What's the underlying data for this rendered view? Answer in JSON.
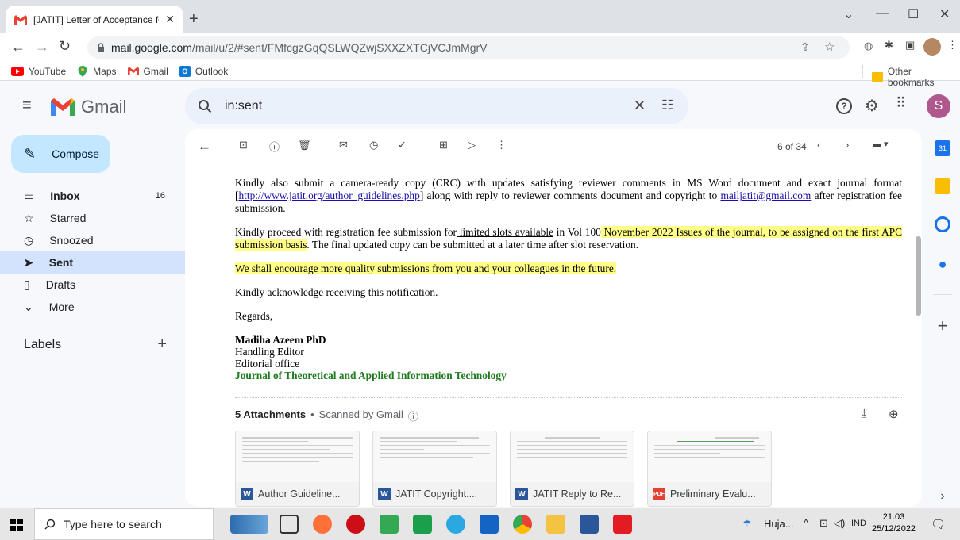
{
  "browser": {
    "tab_title": "[JATIT] Letter of Acceptance for S",
    "url_host": "mail.google.com",
    "url_path": "/mail/u/2/#sent/FMfcgzGqQSLWQZwjSXXZXTCjVCJmMgrV",
    "bookmarks": [
      "YouTube",
      "Maps",
      "Gmail",
      "Outlook"
    ],
    "other_bookmarks": "Other bookmarks"
  },
  "gmail": {
    "logo_text": "Gmail",
    "search_value": "in:sent",
    "compose_label": "Compose",
    "avatar_letter": "S",
    "nav": [
      {
        "label": "Inbox",
        "count": "16"
      },
      {
        "label": "Starred",
        "count": ""
      },
      {
        "label": "Snoozed",
        "count": ""
      },
      {
        "label": "Sent",
        "count": ""
      },
      {
        "label": "Drafts",
        "count": ""
      },
      {
        "label": "More",
        "count": ""
      }
    ],
    "labels_heading": "Labels",
    "pager": "6 of 34"
  },
  "email": {
    "p1_a": "Kindly also submit a camera-ready copy (CRC) with updates satisfying reviewer comments in MS Word document and exact journal format [",
    "p1_link": "http://www.jatit.org/author_guidelines.php",
    "p1_b": "] along with reply to reviewer comments document and copyright to ",
    "p1_email": "mailjatit@gmail.com",
    "p1_c": " after registration fee submission.",
    "p2_a": "Kindly proceed with registration fee submission for",
    "p2_u": " limited slots available",
    "p2_b": " in Vol 100",
    "p2_hl": "  November 2022  Issues of the journal, to be assigned on the first APC submission basis",
    "p2_c": ". The final updated copy can be submitted at a later time after slot reservation.",
    "p3": "We shall encourage more quality submissions from you and your colleagues in the future.",
    "p4": "Kindly acknowledge receiving this notification.",
    "regards": "Regards,",
    "sig_name": "Madiha Azeem PhD",
    "sig_role": "Handling Editor",
    "sig_office": "Editorial office",
    "sig_journal": "Journal of Theoretical and Applied Information Technology"
  },
  "attachments": {
    "heading": "5 Attachments",
    "scanned": "Scanned by Gmail",
    "items": [
      {
        "name": "Author Guideline...",
        "type": "W"
      },
      {
        "name": "JATIT Copyright....",
        "type": "W"
      },
      {
        "name": "JATIT Reply to Re...",
        "type": "W"
      },
      {
        "name": "Preliminary Evalu...",
        "type": "PDF"
      }
    ]
  },
  "taskbar": {
    "search_placeholder": "Type here to search",
    "weather": "Huja...",
    "lang": "IND",
    "time": "21.03",
    "date": "25/12/2022"
  },
  "colors": {
    "accent": "#0b57d0",
    "highlight": "#ffff88",
    "journal_green": "#1e7a1e",
    "word_blue": "#2b579a",
    "pdf_red": "#e44134"
  }
}
